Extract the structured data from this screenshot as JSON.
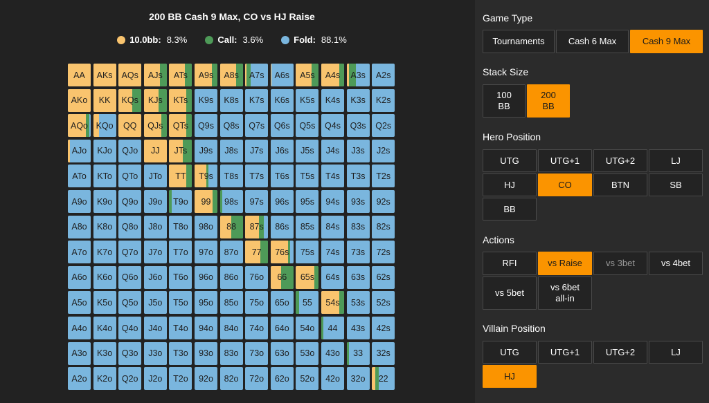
{
  "chart": {
    "title": "200 BB Cash 9 Max, CO vs HJ Raise",
    "legend": [
      {
        "label": "10.0bb:",
        "value": "8.3%",
        "color": "#f9c46e"
      },
      {
        "label": "Call:",
        "value": "3.6%",
        "color": "#4e9a58"
      },
      {
        "label": "Fold:",
        "value": "88.1%",
        "color": "#7ab6de"
      }
    ]
  },
  "colors": {
    "raise": "#f9c46e",
    "call": "#4e9a58",
    "fold": "#7ab6de",
    "accent": "#fb9400"
  },
  "grid": [
    [
      [
        "AA",
        1,
        0
      ],
      [
        "AKs",
        1,
        0
      ],
      [
        "AQs",
        1,
        0
      ],
      [
        "AJs",
        0.7,
        0.3
      ],
      [
        "ATs",
        0.7,
        0.3
      ],
      [
        "A9s",
        0.75,
        0.25
      ],
      [
        "A8s",
        0.7,
        0.3
      ],
      [
        "A7s",
        0.05,
        0.2
      ],
      [
        "A6s",
        0.05,
        0
      ],
      [
        "A5s",
        0.7,
        0.3
      ],
      [
        "A4s",
        0.8,
        0.2
      ],
      [
        "A3s",
        0.1,
        0.3
      ],
      [
        "A2s",
        0,
        0
      ]
    ],
    [
      [
        "AKo",
        1,
        0
      ],
      [
        "KK",
        1,
        0
      ],
      [
        "KQs",
        0.6,
        0.4
      ],
      [
        "KJs",
        0.65,
        0.35
      ],
      [
        "KTs",
        0.75,
        0.25
      ],
      [
        "K9s",
        0,
        0
      ],
      [
        "K8s",
        0,
        0
      ],
      [
        "K7s",
        0,
        0
      ],
      [
        "K6s",
        0,
        0
      ],
      [
        "K5s",
        0,
        0
      ],
      [
        "K4s",
        0,
        0
      ],
      [
        "K3s",
        0,
        0
      ],
      [
        "K2s",
        0,
        0
      ]
    ],
    [
      [
        "AQo",
        0.8,
        0.15
      ],
      [
        "KQo",
        0.25,
        0
      ],
      [
        "QQ",
        1,
        0
      ],
      [
        "QJs",
        0.75,
        0.25
      ],
      [
        "QTs",
        0.75,
        0.25
      ],
      [
        "Q9s",
        0,
        0
      ],
      [
        "Q8s",
        0,
        0
      ],
      [
        "Q7s",
        0,
        0
      ],
      [
        "Q6s",
        0,
        0
      ],
      [
        "Q5s",
        0,
        0
      ],
      [
        "Q4s",
        0,
        0
      ],
      [
        "Q3s",
        0,
        0
      ],
      [
        "Q2s",
        0,
        0
      ]
    ],
    [
      [
        "AJo",
        0.1,
        0
      ],
      [
        "KJo",
        0,
        0
      ],
      [
        "QJo",
        0,
        0
      ],
      [
        "JJ",
        1,
        0
      ],
      [
        "JTs",
        0.6,
        0.4
      ],
      [
        "J9s",
        0,
        0
      ],
      [
        "J8s",
        0,
        0
      ],
      [
        "J7s",
        0,
        0
      ],
      [
        "J6s",
        0,
        0
      ],
      [
        "J5s",
        0,
        0
      ],
      [
        "J4s",
        0,
        0
      ],
      [
        "J3s",
        0,
        0
      ],
      [
        "J2s",
        0,
        0
      ]
    ],
    [
      [
        "ATo",
        0,
        0
      ],
      [
        "KTo",
        0,
        0
      ],
      [
        "QTo",
        0,
        0
      ],
      [
        "JTo",
        0,
        0
      ],
      [
        "TT",
        0.75,
        0.25
      ],
      [
        "T9s",
        0.5,
        0.1
      ],
      [
        "T8s",
        0,
        0
      ],
      [
        "T7s",
        0,
        0
      ],
      [
        "T6s",
        0,
        0
      ],
      [
        "T5s",
        0,
        0
      ],
      [
        "T4s",
        0,
        0
      ],
      [
        "T3s",
        0,
        0
      ],
      [
        "T2s",
        0,
        0
      ]
    ],
    [
      [
        "A9o",
        0,
        0
      ],
      [
        "K9o",
        0,
        0
      ],
      [
        "Q9o",
        0,
        0
      ],
      [
        "J9o",
        0,
        0
      ],
      [
        "T9o",
        0,
        0.1
      ],
      [
        "99",
        0.8,
        0.2
      ],
      [
        "98s",
        0,
        0.1
      ],
      [
        "97s",
        0,
        0
      ],
      [
        "96s",
        0,
        0
      ],
      [
        "95s",
        0,
        0
      ],
      [
        "94s",
        0,
        0
      ],
      [
        "93s",
        0,
        0
      ],
      [
        "92s",
        0,
        0
      ]
    ],
    [
      [
        "A8o",
        0,
        0
      ],
      [
        "K8o",
        0,
        0
      ],
      [
        "Q8o",
        0,
        0
      ],
      [
        "J8o",
        0,
        0
      ],
      [
        "T8o",
        0,
        0
      ],
      [
        "98o",
        0,
        0
      ],
      [
        "88",
        0.5,
        0.5
      ],
      [
        "87s",
        0.6,
        0.2
      ],
      [
        "86s",
        0,
        0
      ],
      [
        "85s",
        0,
        0
      ],
      [
        "84s",
        0,
        0
      ],
      [
        "83s",
        0,
        0
      ],
      [
        "82s",
        0,
        0
      ]
    ],
    [
      [
        "A7o",
        0,
        0
      ],
      [
        "K7o",
        0,
        0
      ],
      [
        "Q7o",
        0,
        0
      ],
      [
        "J7o",
        0,
        0
      ],
      [
        "T7o",
        0,
        0
      ],
      [
        "97o",
        0,
        0
      ],
      [
        "87o",
        0,
        0
      ],
      [
        "77",
        0.65,
        0.35
      ],
      [
        "76s",
        0.75,
        0.1
      ],
      [
        "75s",
        0,
        0
      ],
      [
        "74s",
        0,
        0
      ],
      [
        "73s",
        0,
        0
      ],
      [
        "72s",
        0,
        0
      ]
    ],
    [
      [
        "A6o",
        0,
        0
      ],
      [
        "K6o",
        0,
        0
      ],
      [
        "Q6o",
        0,
        0
      ],
      [
        "J6o",
        0,
        0
      ],
      [
        "T6o",
        0,
        0
      ],
      [
        "96o",
        0,
        0
      ],
      [
        "86o",
        0,
        0
      ],
      [
        "76o",
        0,
        0
      ],
      [
        "66",
        0.45,
        0.55
      ],
      [
        "65s",
        0.8,
        0.2
      ],
      [
        "64s",
        0,
        0
      ],
      [
        "63s",
        0,
        0
      ],
      [
        "62s",
        0,
        0
      ]
    ],
    [
      [
        "A5o",
        0,
        0
      ],
      [
        "K5o",
        0,
        0
      ],
      [
        "Q5o",
        0,
        0
      ],
      [
        "J5o",
        0,
        0
      ],
      [
        "T5o",
        0,
        0
      ],
      [
        "95o",
        0,
        0
      ],
      [
        "85o",
        0,
        0
      ],
      [
        "75o",
        0,
        0
      ],
      [
        "65o",
        0,
        0
      ],
      [
        "55",
        0,
        0.15
      ],
      [
        "54s",
        0.8,
        0.2
      ],
      [
        "53s",
        0,
        0
      ],
      [
        "52s",
        0,
        0
      ]
    ],
    [
      [
        "A4o",
        0,
        0
      ],
      [
        "K4o",
        0,
        0
      ],
      [
        "Q4o",
        0,
        0
      ],
      [
        "J4o",
        0,
        0
      ],
      [
        "T4o",
        0,
        0
      ],
      [
        "94o",
        0,
        0
      ],
      [
        "84o",
        0,
        0
      ],
      [
        "74o",
        0,
        0
      ],
      [
        "64o",
        0,
        0
      ],
      [
        "54o",
        0,
        0
      ],
      [
        "44",
        0,
        0.1
      ],
      [
        "43s",
        0,
        0
      ],
      [
        "42s",
        0,
        0
      ]
    ],
    [
      [
        "A3o",
        0,
        0
      ],
      [
        "K3o",
        0,
        0
      ],
      [
        "Q3o",
        0,
        0
      ],
      [
        "J3o",
        0,
        0
      ],
      [
        "T3o",
        0,
        0
      ],
      [
        "93o",
        0,
        0
      ],
      [
        "83o",
        0,
        0
      ],
      [
        "73o",
        0,
        0
      ],
      [
        "63o",
        0,
        0
      ],
      [
        "53o",
        0,
        0
      ],
      [
        "43o",
        0,
        0
      ],
      [
        "33",
        0,
        0.1
      ],
      [
        "32s",
        0,
        0
      ]
    ],
    [
      [
        "A2o",
        0,
        0
      ],
      [
        "K2o",
        0,
        0
      ],
      [
        "Q2o",
        0,
        0
      ],
      [
        "J2o",
        0,
        0
      ],
      [
        "T2o",
        0,
        0
      ],
      [
        "92o",
        0,
        0
      ],
      [
        "82o",
        0,
        0
      ],
      [
        "72o",
        0,
        0
      ],
      [
        "62o",
        0,
        0
      ],
      [
        "52o",
        0,
        0
      ],
      [
        "42o",
        0,
        0
      ],
      [
        "32o",
        0,
        0
      ],
      [
        "22",
        0.15,
        0.15
      ]
    ]
  ],
  "panel": {
    "game_type": {
      "label": "Game Type",
      "options": [
        {
          "label": "Tournaments",
          "active": false
        },
        {
          "label": "Cash 6 Max",
          "active": false
        },
        {
          "label": "Cash 9 Max",
          "active": true
        }
      ]
    },
    "stack_size": {
      "label": "Stack Size",
      "options": [
        {
          "line1": "100",
          "line2": "BB",
          "active": false
        },
        {
          "line1": "200",
          "line2": "BB",
          "active": true
        }
      ]
    },
    "hero_position": {
      "label": "Hero Position",
      "options": [
        {
          "label": "UTG",
          "active": false
        },
        {
          "label": "UTG+1",
          "active": false
        },
        {
          "label": "UTG+2",
          "active": false
        },
        {
          "label": "LJ",
          "active": false
        },
        {
          "label": "HJ",
          "active": false
        },
        {
          "label": "CO",
          "active": true
        },
        {
          "label": "BTN",
          "active": false
        },
        {
          "label": "SB",
          "active": false
        },
        {
          "label": "BB",
          "active": false
        }
      ]
    },
    "actions": {
      "label": "Actions",
      "options": [
        {
          "line1": "RFI",
          "line2": "",
          "state": "normal"
        },
        {
          "line1": "vs Raise",
          "line2": "",
          "state": "active"
        },
        {
          "line1": "vs 3bet",
          "line2": "",
          "state": "dim"
        },
        {
          "line1": "vs 4bet",
          "line2": "",
          "state": "normal"
        },
        {
          "line1": "vs 5bet",
          "line2": "",
          "state": "normal"
        },
        {
          "line1": "vs 6bet",
          "line2": "all-in",
          "state": "normal"
        }
      ]
    },
    "villain_position": {
      "label": "Villain Position",
      "options": [
        {
          "label": "UTG",
          "active": false
        },
        {
          "label": "UTG+1",
          "active": false
        },
        {
          "label": "UTG+2",
          "active": false
        },
        {
          "label": "LJ",
          "active": false
        },
        {
          "label": "HJ",
          "active": true
        }
      ]
    }
  }
}
